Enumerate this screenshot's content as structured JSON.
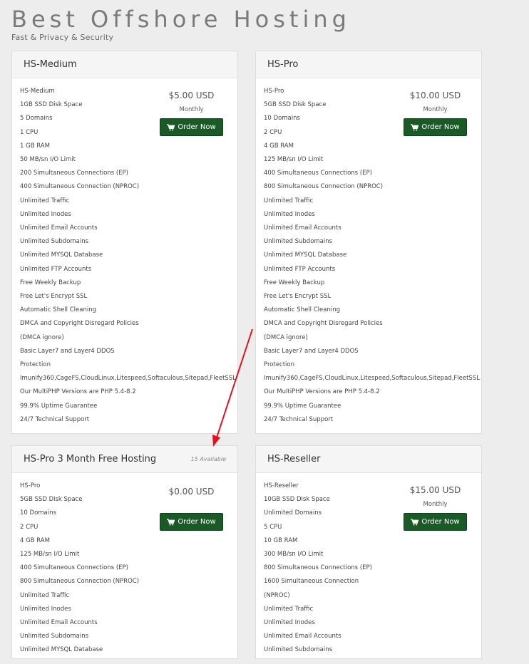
{
  "page": {
    "title": "Best Offshore Hosting",
    "subtitle": "Fast & Privacy & Security"
  },
  "colors": {
    "button": "#1a5a27",
    "annotation_arrow": "#e8101b"
  },
  "products": [
    {
      "name": "HS-Medium",
      "available": "",
      "price": "$5.00 USD",
      "cycle": "Monthly",
      "order_label": "Order Now",
      "features": [
        "HS-Medium",
        "1GB SSD Disk Space",
        "5 Domains",
        "1 CPU",
        "1 GB RAM",
        "50 MB/sn I/O Limit",
        "200 Simultaneous Connections (EP)",
        "400 Simultaneous Connection (NPROC)",
        "Unlimited Traffic",
        "Unlimited Inodes",
        "Unlimited Email Accounts",
        "Unlimited Subdomains",
        "Unlimited MYSQL Database",
        "Unlimited FTP Accounts",
        "Free Weekly Backup",
        "Free Let's Encrypt SSL",
        "Automatic Shell Cleaning",
        "DMCA and Copyright Disregard Policies",
        "(DMCA ignore)",
        "Basic Layer7 and Layer4 DDOS",
        "Protection",
        "Imunify360,CageFS,CloudLinux,Litespeed,Softaculous,Sitepad,FleetSSL",
        "Our MultiPHP Versions are PHP 5.4-8.2",
        "99.9% Uptime Guarantee",
        "24/7 Technical Support"
      ]
    },
    {
      "name": "HS-Pro",
      "available": "",
      "price": "$10.00 USD",
      "cycle": "Monthly",
      "order_label": "Order Now",
      "features": [
        "HS-Pro",
        "5GB SSD Disk Space",
        "10 Domains",
        "2 CPU",
        "4 GB RAM",
        "125 MB/sn I/O Limit",
        "400 Simultaneous Connections (EP)",
        "800 Simultaneous Connection (NPROC)",
        "Unlimited Traffic",
        "Unlimited Inodes",
        "Unlimited Email Accounts",
        "Unlimited Subdomains",
        "Unlimited MYSQL Database",
        "Unlimited FTP Accounts",
        "Free Weekly Backup",
        "Free Let's Encrypt SSL",
        "Automatic Shell Cleaning",
        "DMCA and Copyright Disregard Policies",
        "(DMCA ignore)",
        "Basic Layer7 and Layer4 DDOS",
        "Protection",
        "Imunify360,CageFS,CloudLinux,Litespeed,Softaculous,Sitepad,FleetSSL",
        "Our MultiPHP Versions are PHP 5.4-8.2",
        "99.9% Uptime Guarantee",
        "24/7 Technical Support"
      ]
    },
    {
      "name": "HS-Pro 3 Month Free Hosting",
      "available": "15 Available",
      "price": "$0.00 USD",
      "cycle": "",
      "order_label": "Order Now",
      "features": [
        "HS-Pro",
        "5GB SSD Disk Space",
        "10 Domains",
        "2 CPU",
        "4 GB RAM",
        "125 MB/sn I/O Limit",
        "400 Simultaneous Connections (EP)",
        "800 Simultaneous Connection (NPROC)",
        "Unlimited Traffic",
        "Unlimited Inodes",
        "Unlimited Email Accounts",
        "Unlimited Subdomains",
        "Unlimited MYSQL Database"
      ]
    },
    {
      "name": "HS-Reseller",
      "available": "",
      "price": "$15.00 USD",
      "cycle": "Monthly",
      "order_label": "Order Now",
      "features": [
        "HS-Reseller",
        "10GB SSD Disk Space",
        "Unlimited Domains",
        "5 CPU",
        "10 GB RAM",
        "300 MB/sn I/O Limit",
        "800 Simultaneous Connections (EP)",
        "1600 Simultaneous Connection",
        "(NPROC)",
        "Unlimited Traffic",
        "Unlimited Inodes",
        "Unlimited Email Accounts",
        "Unlimited Subdomains"
      ]
    }
  ]
}
